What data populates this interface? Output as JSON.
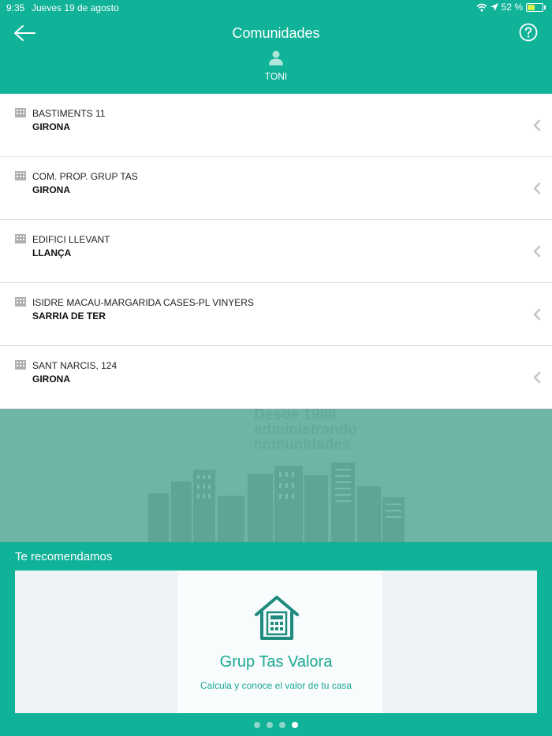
{
  "status_bar": {
    "time": "9:35",
    "date": "Jueves 19 de agosto",
    "battery": "52 %",
    "battery_level": 0.52
  },
  "header": {
    "title": "Comunidades",
    "user_name": "TONI",
    "back_icon": "arrow-left-icon",
    "help_icon": "question-circle-icon"
  },
  "communities": [
    {
      "name": "BASTIMENTS 11",
      "city": "GIRONA"
    },
    {
      "name": "COM. PROP. GRUP TAS",
      "city": "GIRONA"
    },
    {
      "name": "EDIFICI LLEVANT",
      "city": "LLANÇA"
    },
    {
      "name": "ISIDRE MACAU-MARGARIDA CASES-PL VINYERS",
      "city": "SARRIA DE TER"
    },
    {
      "name": "SANT NARCIS, 124",
      "city": "GIRONA"
    }
  ],
  "banner": {
    "slogan_lines": [
      "Desde 1988",
      "administrando",
      "comunidades"
    ]
  },
  "recommend": {
    "title": "Te recomendamos",
    "card_title": "Grup Tas Valora",
    "card_subtitle": "Calcula y conoce el valor de tu casa",
    "page_count": 4,
    "active_page": 3
  },
  "colors": {
    "primary": "#10b298",
    "banner": "#6fb4a6",
    "accent_text": "#1aa894"
  }
}
